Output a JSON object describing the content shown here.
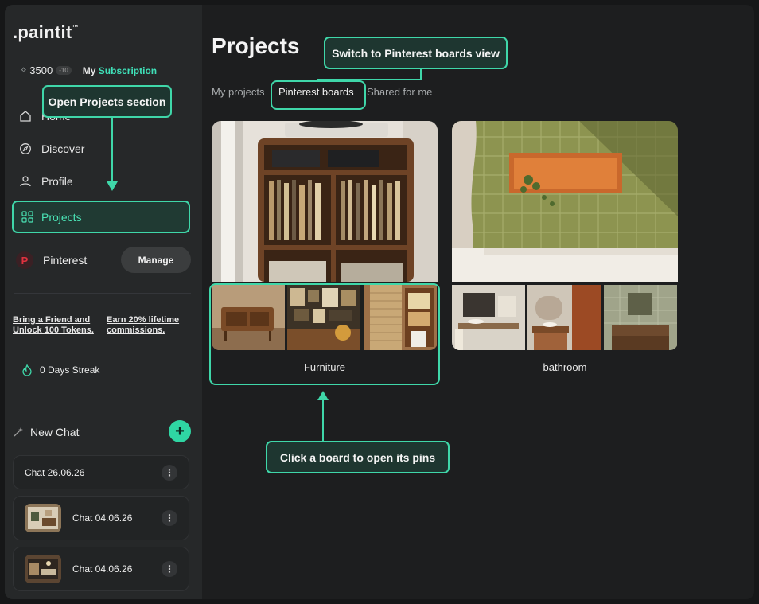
{
  "app": {
    "logo": ".paintit",
    "logo_mark": "™"
  },
  "account": {
    "tokens": "3500",
    "token_delta": "-10",
    "subscription_prefix": "My ",
    "subscription_highlight": "Subscription"
  },
  "sidebar": {
    "nav": [
      {
        "label": "Home",
        "icon": "home-icon"
      },
      {
        "label": "Discover",
        "icon": "compass-icon"
      },
      {
        "label": "Profile",
        "icon": "user-icon"
      },
      {
        "label": "Projects",
        "icon": "grid-icon"
      }
    ],
    "pinterest": {
      "label": "Pinterest",
      "manage_label": "Manage"
    },
    "referral": {
      "bring_friend": "Bring a Friend and Unlock 100 Tokens.",
      "earn": "Earn 20% lifetime commissions."
    },
    "streak": "0 Days Streak",
    "new_chat": "New Chat",
    "chats": [
      {
        "label": "Chat 26.06.26",
        "has_thumb": false
      },
      {
        "label": "Chat 04.06.26",
        "has_thumb": true
      },
      {
        "label": "Chat 04.06.26",
        "has_thumb": true
      }
    ]
  },
  "main": {
    "title": "Projects",
    "tabs": [
      {
        "label": "My projects",
        "active": false
      },
      {
        "label": "Pinterest boards",
        "active": true
      },
      {
        "label": "Shared for me",
        "active": false
      }
    ],
    "boards": [
      {
        "name": "Furniture"
      },
      {
        "name": "bathroom"
      }
    ]
  },
  "callouts": {
    "projects": "Open Projects section",
    "pinterest_view": "Switch to Pinterest boards view",
    "board": "Click a board to open its pins"
  },
  "colors": {
    "accent": "#3fd7a9",
    "background": "#1d1e1f",
    "sidebar": "#262829"
  }
}
